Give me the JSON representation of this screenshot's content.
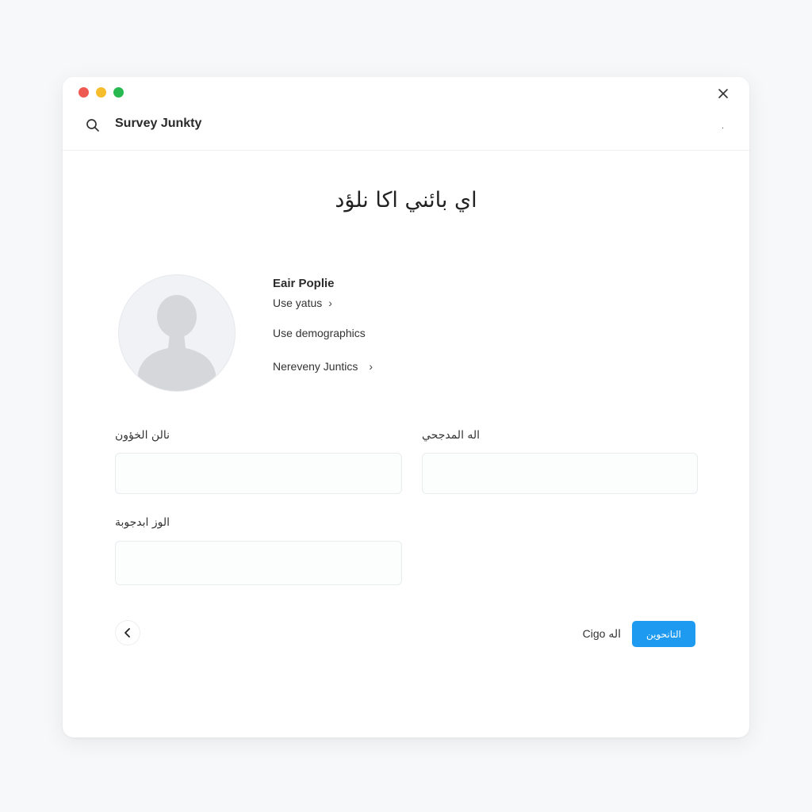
{
  "window": {
    "traffic_lights": {
      "close_color": "#ee5a52",
      "minimize_color": "#f6be2d",
      "zoom_color": "#27b84f"
    }
  },
  "header": {
    "search_icon": "search-icon",
    "title": "Survey Junkty",
    "menu_glyph": "·"
  },
  "page": {
    "title": "اي بائني اكا نلؤد"
  },
  "profile": {
    "avatar_icon": "user-silhouette",
    "name": "Eair Poplie",
    "link_status": "Use yatus",
    "demographics": "Use demographics",
    "link_junctions": "Nereveny Juntics"
  },
  "form": {
    "field1_label": "نالن الخؤون",
    "field1_value": "",
    "field2_label": "اله المدجحي",
    "field2_value": "",
    "field3_label": "الوز ابدجوبة",
    "field3_value": ""
  },
  "footer": {
    "back_icon": "chevron-left-icon",
    "secondary_label": "Cigo اله",
    "primary_label": "التانحوين",
    "primary_color": "#1e9bf0"
  }
}
